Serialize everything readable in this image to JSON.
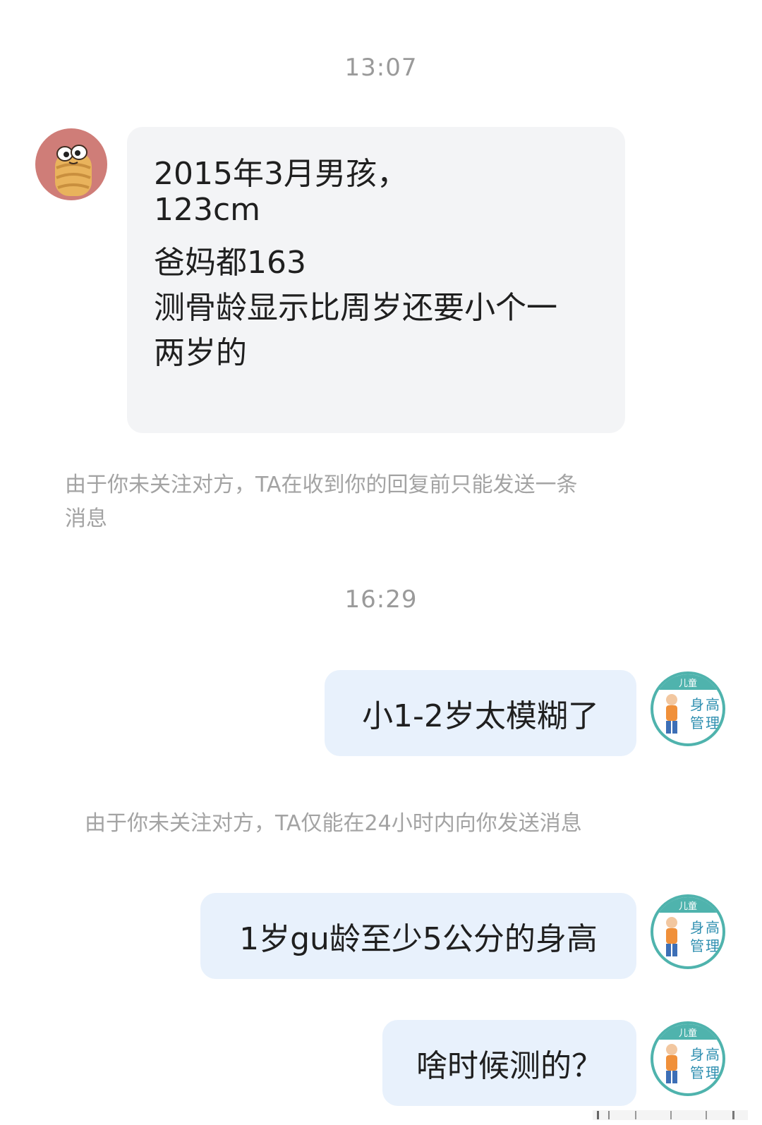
{
  "chat": {
    "timestamp_1": "13:07",
    "incoming_message": {
      "lines": [
        "2015年3月男孩，",
        "123cm",
        "爸妈都163",
        "测骨龄显示比周岁还要小个一",
        "两岁的"
      ]
    },
    "notice_1": {
      "line1": "由于你未关注对方，TA在收到你的回复前只能发送一条",
      "line2": "消息"
    },
    "timestamp_2": "16:29",
    "outgoing_1": "小1-2岁太模糊了",
    "notice_2": "由于你未关注对方，TA仅能在24小时内向你发送消息",
    "outgoing_2": "1岁gu龄至少5公分的身高",
    "outgoing_3": "啥时候测的？",
    "brand_avatar": {
      "top": "儿童",
      "c1": "身",
      "c2": "高",
      "c3": "管",
      "c4": "理"
    }
  },
  "colors": {
    "incoming_bubble": "#f3f4f6",
    "outgoing_bubble": "#e8f1fc",
    "timestamp_text": "#9a9a9a",
    "notice_text": "#a3a3a3",
    "brand_teal": "#4fb3ad",
    "left_avatar_bg": "#cf7d78"
  }
}
